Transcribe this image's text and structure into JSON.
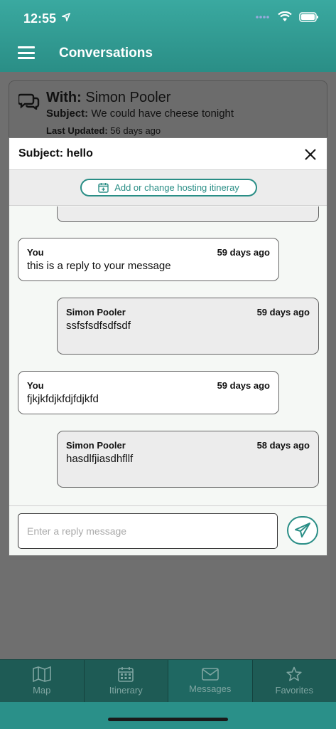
{
  "status": {
    "time": "12:55"
  },
  "header": {
    "title": "Conversations"
  },
  "background_card": {
    "with_label": "With:",
    "with_name": "Simon Pooler",
    "subject_label": "Subject:",
    "subject_value": "We could have cheese tonight",
    "updated_label": "Last Updated:",
    "updated_value": "56 days ago"
  },
  "modal": {
    "subject": "Subject: hello",
    "itinerary_button": "Add or change hosting itineray",
    "messages": [
      {
        "sender": "You",
        "time": "59 days ago",
        "text": "this is a reply to your message",
        "mine": true
      },
      {
        "sender": "Simon Pooler",
        "time": "59 days ago",
        "text": "ssfsfsdfsdfsdf",
        "mine": false
      },
      {
        "sender": "You",
        "time": "59 days ago",
        "text": "fjkjkfdjkfdjfdjkfd",
        "mine": true
      },
      {
        "sender": "Simon Pooler",
        "time": "58 days ago",
        "text": "hasdlfjiasdhfllf",
        "mine": false
      }
    ],
    "reply_placeholder": "Enter a reply message"
  },
  "tabs": [
    {
      "label": "Map",
      "icon": "map-icon"
    },
    {
      "label": "Itinerary",
      "icon": "calendar-icon"
    },
    {
      "label": "Messages",
      "icon": "envelope-icon",
      "active": true
    },
    {
      "label": "Favorites",
      "icon": "star-icon"
    }
  ],
  "colors": {
    "accent": "#2a8e86",
    "tabbar": "#1e5b55"
  }
}
